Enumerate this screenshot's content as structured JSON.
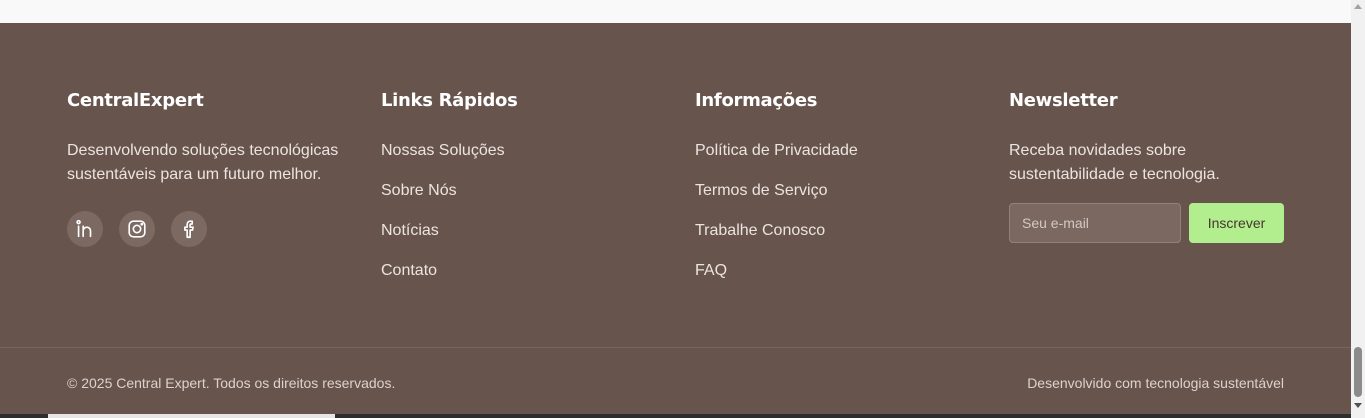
{
  "brand": {
    "title": "CentralExpert",
    "description": "Desenvolvendo soluções tecnológicas sustentáveis para um futuro melhor."
  },
  "socials": [
    {
      "icon": "linkedin-icon",
      "label": "LinkedIn"
    },
    {
      "icon": "instagram-icon",
      "label": "Instagram"
    },
    {
      "icon": "facebook-icon",
      "label": "Facebook"
    }
  ],
  "quick_links": {
    "title": "Links Rápidos",
    "items": [
      "Nossas Soluções",
      "Sobre Nós",
      "Notícias",
      "Contato"
    ]
  },
  "info": {
    "title": "Informações",
    "items": [
      "Política de Privacidade",
      "Termos de Serviço",
      "Trabalhe Conosco",
      "FAQ"
    ]
  },
  "newsletter": {
    "title": "Newsletter",
    "description": "Receba novidades sobre sustentabilidade e tecnologia.",
    "input_placeholder": "Seu e-mail",
    "input_value": "",
    "button_label": "Inscrever"
  },
  "bottom": {
    "copyright": "© 2025 Central Expert. Todos os direitos reservados.",
    "tagline": "Desenvolvido com tecnologia sustentável"
  },
  "colors": {
    "footer_bg": "#67544d",
    "accent_button": "#b3ee8e",
    "social_bg": "#7b6962"
  }
}
